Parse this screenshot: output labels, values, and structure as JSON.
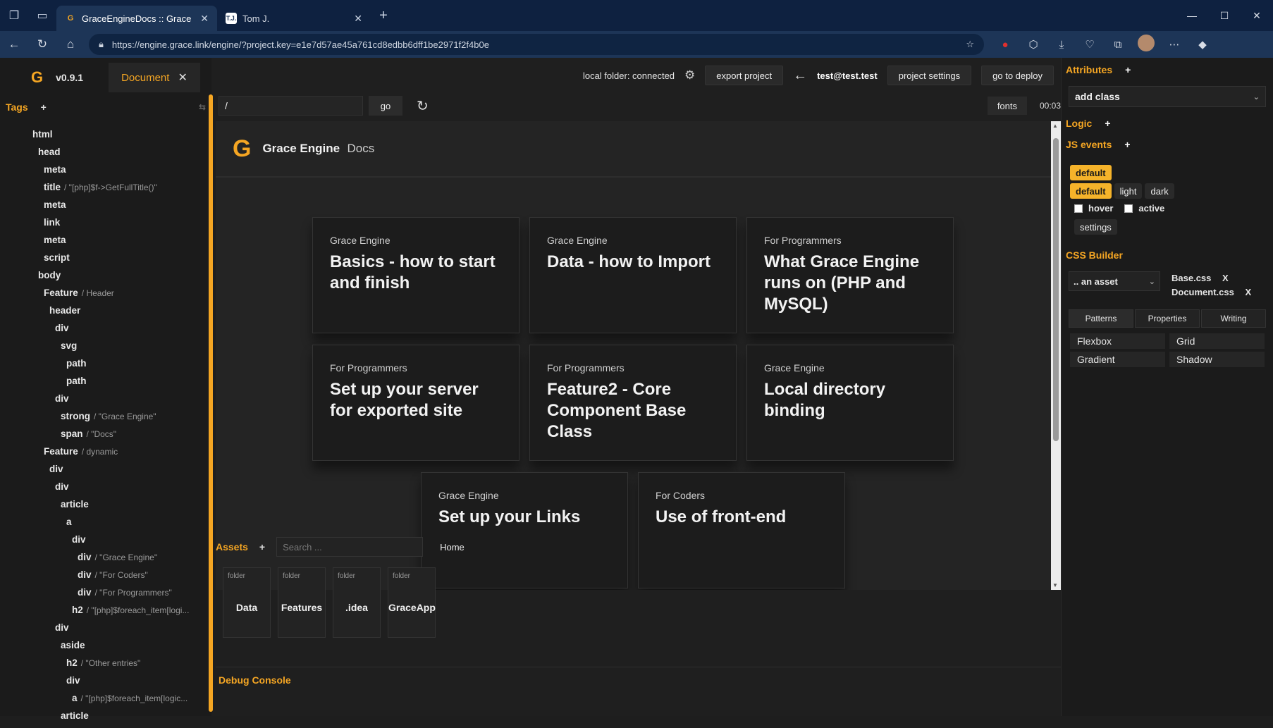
{
  "browser": {
    "tabs": [
      {
        "label": "GraceEngineDocs :: Grace Engine",
        "favicon": "G"
      },
      {
        "label": "Tom J.",
        "favicon": "TJ"
      }
    ],
    "url": "https://engine.grace.link/engine/?project.key=e1e7d57ae45a761cd8edbb6dff1be2971f2f4b0e"
  },
  "app": {
    "version": "v0.9.1",
    "doc_tab": "Document",
    "tags_label": "Tags",
    "tree": [
      {
        "tag": "html",
        "depth": 0,
        "meta": ""
      },
      {
        "tag": "head",
        "depth": 1,
        "meta": ""
      },
      {
        "tag": "meta",
        "depth": 2,
        "meta": ""
      },
      {
        "tag": "title",
        "depth": 2,
        "meta": "/ \"[php]$f->GetFullTitle()\""
      },
      {
        "tag": "meta",
        "depth": 2,
        "meta": ""
      },
      {
        "tag": "link",
        "depth": 2,
        "meta": ""
      },
      {
        "tag": "meta",
        "depth": 2,
        "meta": ""
      },
      {
        "tag": "script",
        "depth": 2,
        "meta": ""
      },
      {
        "tag": "body",
        "depth": 1,
        "meta": ""
      },
      {
        "tag": "Feature",
        "depth": 2,
        "meta": "/ Header"
      },
      {
        "tag": "header",
        "depth": 3,
        "meta": ""
      },
      {
        "tag": "div",
        "depth": 4,
        "meta": ""
      },
      {
        "tag": "svg",
        "depth": 5,
        "meta": ""
      },
      {
        "tag": "path",
        "depth": 6,
        "meta": ""
      },
      {
        "tag": "path",
        "depth": 6,
        "meta": ""
      },
      {
        "tag": "div",
        "depth": 4,
        "meta": ""
      },
      {
        "tag": "strong",
        "depth": 5,
        "meta": "/ \"Grace Engine\""
      },
      {
        "tag": "span",
        "depth": 5,
        "meta": "/ \"Docs\""
      },
      {
        "tag": "Feature",
        "depth": 2,
        "meta": "/ dynamic"
      },
      {
        "tag": "div",
        "depth": 3,
        "meta": ""
      },
      {
        "tag": "div",
        "depth": 4,
        "meta": ""
      },
      {
        "tag": "article",
        "depth": 5,
        "meta": ""
      },
      {
        "tag": "a",
        "depth": 6,
        "meta": ""
      },
      {
        "tag": "div",
        "depth": 7,
        "meta": ""
      },
      {
        "tag": "div",
        "depth": 8,
        "meta": "/ \"Grace Engine\""
      },
      {
        "tag": "div",
        "depth": 8,
        "meta": "/ \"For Coders\""
      },
      {
        "tag": "div",
        "depth": 8,
        "meta": "/ \"For Programmers\""
      },
      {
        "tag": "h2",
        "depth": 7,
        "meta": "/ \"[php]$foreach_item[logi..."
      },
      {
        "tag": "div",
        "depth": 4,
        "meta": ""
      },
      {
        "tag": "aside",
        "depth": 5,
        "meta": ""
      },
      {
        "tag": "h2",
        "depth": 6,
        "meta": "/ \"Other entries\""
      },
      {
        "tag": "div",
        "depth": 6,
        "meta": ""
      },
      {
        "tag": "a",
        "depth": 7,
        "meta": "/ \"[php]$foreach_item[logic..."
      },
      {
        "tag": "article",
        "depth": 5,
        "meta": ""
      }
    ]
  },
  "topbar": {
    "status": "local folder: connected",
    "export_label": "export project",
    "user": "test@test.test",
    "settings_label": "project settings",
    "deploy_label": "go to deploy",
    "path_value": "/",
    "go_label": "go",
    "fonts_label": "fonts",
    "timer": "00:03"
  },
  "preview": {
    "brand_strong": "Grace Engine",
    "brand_span": "Docs",
    "cards": [
      {
        "cat": "Grace Engine",
        "title": "Basics - how to start and finish"
      },
      {
        "cat": "Grace Engine",
        "title": "Data - how to Import"
      },
      {
        "cat": "For Programmers",
        "title": "What Grace Engine runs on (PHP and MySQL)"
      },
      {
        "cat": "For Programmers",
        "title": "Set up your server for exported site"
      },
      {
        "cat": "For Programmers",
        "title": "Feature2 - Core Component Base Class"
      },
      {
        "cat": "Grace Engine",
        "title": "Local directory binding"
      },
      {
        "cat": "Grace Engine",
        "title": "Set up your Links"
      },
      {
        "cat": "For Coders",
        "title": "Use of front-end"
      }
    ]
  },
  "assets": {
    "label": "Assets",
    "search_placeholder": "Search ...",
    "breadcrumb": "Home",
    "folders": [
      {
        "kind": "folder",
        "name": "Data"
      },
      {
        "kind": "folder",
        "name": "Features"
      },
      {
        "kind": "folder",
        "name": ".idea"
      },
      {
        "kind": "folder",
        "name": "GraceApp"
      }
    ]
  },
  "debug_label": "Debug Console",
  "right": {
    "attributes_label": "Attributes",
    "add_class": "add class",
    "logic_label": "Logic",
    "js_events_label": "JS events",
    "theme_top": "default",
    "themes": [
      "default",
      "light",
      "dark"
    ],
    "hover_label": "hover",
    "active_label": "active",
    "settings_label": "settings",
    "css_builder_label": "CSS Builder",
    "asset_select": ".. an asset",
    "css_files": [
      "Base.css",
      "Document.css"
    ],
    "remove_label": "X",
    "tabs": [
      "Patterns",
      "Properties",
      "Writing"
    ],
    "patterns": [
      "Flexbox",
      "Grid",
      "Gradient",
      "Shadow"
    ]
  },
  "colors": {
    "accent": "#f5a623",
    "chrome": "#1d3557",
    "bg": "#1f1f1f"
  }
}
